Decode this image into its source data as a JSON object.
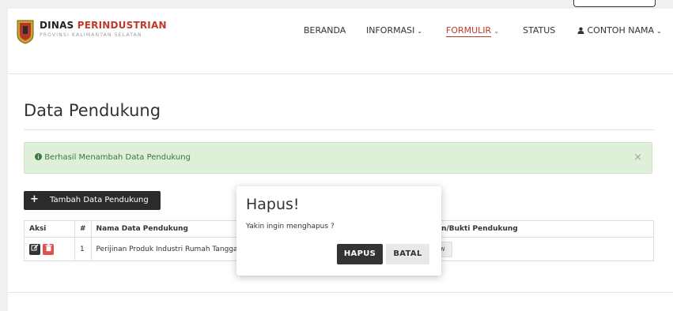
{
  "brand": {
    "title_part1": "DINAS ",
    "title_part2": "PERINDUSTRIAN",
    "subtitle": "PROVINSI KALIMANTAN SELATAN"
  },
  "nav": [
    {
      "label": "BERANDA",
      "caret": ""
    },
    {
      "label": "INFORMASI",
      "caret": "⌄"
    },
    {
      "label": "FORMULIR",
      "caret": "⌄"
    },
    {
      "label": "STATUS",
      "caret": ""
    },
    {
      "label": "CONTOH NAMA",
      "caret": "⌄",
      "icon": "user-icon"
    }
  ],
  "page_title": "Data Pendukung",
  "alert": {
    "message": "Berhasil Menambah Data Pendukung",
    "close": "×"
  },
  "add_button": {
    "label": "Tambah Data Pendukung"
  },
  "table": {
    "headers": [
      "Aksi",
      "#",
      "Nama Data Pendukung",
      "Dokumen/Bukti Pendukung"
    ],
    "rows": [
      {
        "no": "1",
        "name": "Perijinan Produk Industri Rumah Tangga",
        "view_label": "View"
      }
    ]
  },
  "dialog": {
    "title": "Hapus!",
    "message": "Yakin ingin menghapus ?",
    "confirm_label": "HAPUS",
    "cancel_label": "BATAL"
  },
  "colors": {
    "accent": "#c0392b",
    "dark": "#2b2b2b",
    "alert_bg": "#dff0d8",
    "alert_text": "#3c763d",
    "delete": "#d9534f"
  }
}
